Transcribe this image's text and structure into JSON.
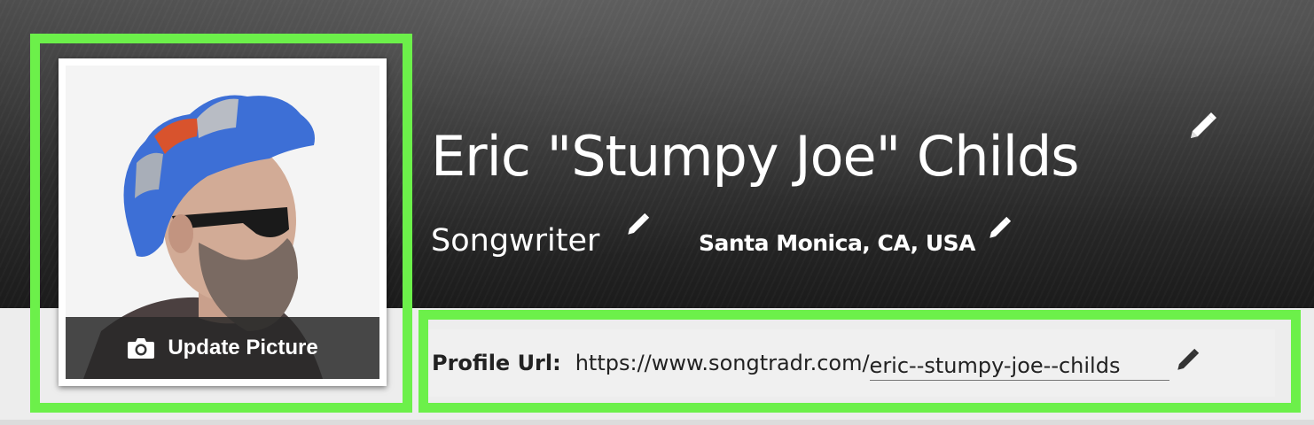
{
  "profile": {
    "name": "Eric \"Stumpy Joe\" Childs",
    "role": "Songwriter",
    "location": "Santa Monica, CA, USA",
    "avatar": {
      "update_label": "Update Picture",
      "icon": "camera-icon"
    },
    "url": {
      "label": "Profile Url:",
      "base": "https://www.songtradr.com/",
      "slug": "eric--stumpy-joe--childs"
    }
  },
  "icons": {
    "edit": "pencil-icon"
  },
  "colors": {
    "highlight": "#6cf04a",
    "banner_dark": "#1b1b1b",
    "text_light": "#ffffff"
  }
}
